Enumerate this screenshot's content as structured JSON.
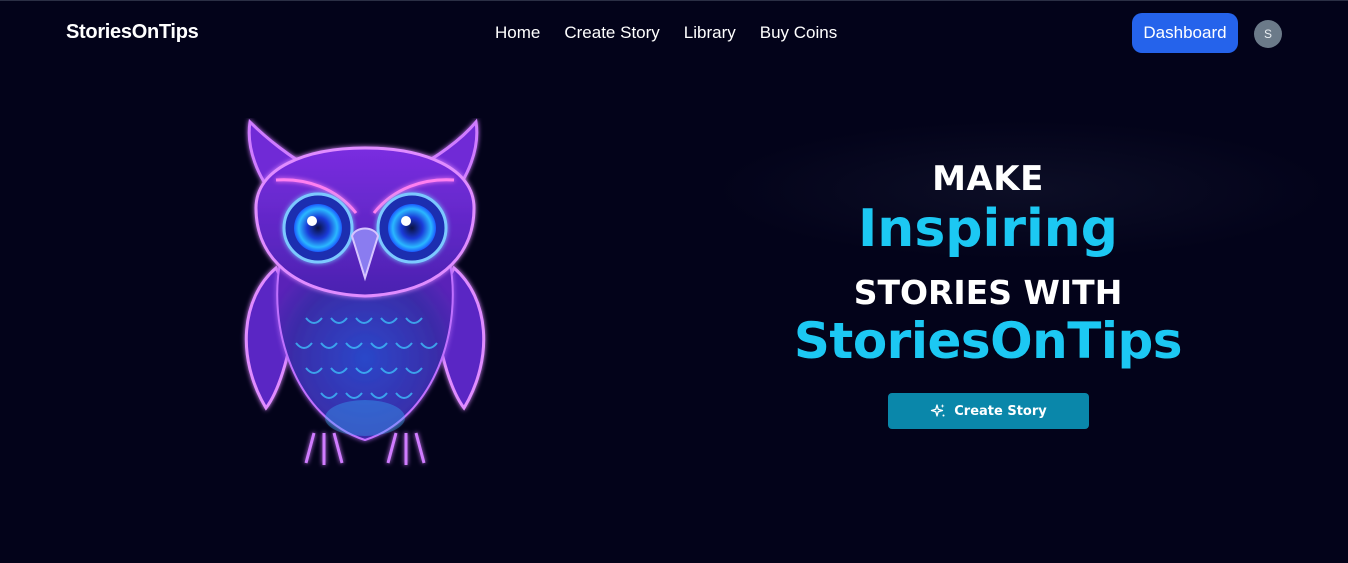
{
  "header": {
    "brand": "StoriesOnTips",
    "nav": [
      {
        "label": "Home"
      },
      {
        "label": "Create Story"
      },
      {
        "label": "Library"
      },
      {
        "label": "Buy Coins"
      }
    ],
    "dashboard_label": "Dashboard",
    "avatar_initial": "S"
  },
  "hero": {
    "line1": "MAKE",
    "line2": "Inspiring",
    "line3": "STORIES WITH",
    "line4": "StoriesOnTips",
    "cta_label": "Create Story",
    "cta_icon": "sparkles-icon"
  },
  "colors": {
    "background": "#03031a",
    "accent": "#1cc8f3",
    "primary_button": "#2563eb",
    "cta_button": "#0a87aa"
  }
}
